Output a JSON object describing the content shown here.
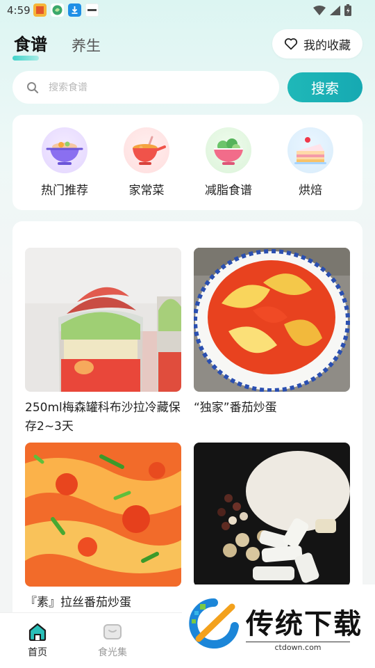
{
  "status_bar": {
    "time": "4:59"
  },
  "header": {
    "tabs": [
      {
        "label": "食谱",
        "active": true
      },
      {
        "label": "养生",
        "active": false
      }
    ],
    "favorites_label": "我的收藏"
  },
  "search": {
    "placeholder": "搜索食谱",
    "button_label": "搜索"
  },
  "categories": [
    {
      "label": "热门推荐",
      "icon": "hot-pot-icon"
    },
    {
      "label": "家常菜",
      "icon": "soup-bowl-icon"
    },
    {
      "label": "减脂食谱",
      "icon": "salad-bowl-icon"
    },
    {
      "label": "烘焙",
      "icon": "cake-icon"
    }
  ],
  "recipes": [
    {
      "title": "250ml梅森罐科布沙拉冷藏保存2~3天"
    },
    {
      "title": "“独家”番茄炒蛋"
    },
    {
      "title": "『素』拉丝番茄炒蛋"
    },
    {
      "title": ""
    }
  ],
  "bottom_nav": [
    {
      "label": "首页",
      "active": true,
      "icon": "home-icon"
    },
    {
      "label": "食光集",
      "active": false,
      "icon": "collection-icon"
    }
  ],
  "watermark": {
    "text": "传统下载",
    "url": "ctdown.com"
  },
  "colors": {
    "accent": "#1fb8b8",
    "active_nav": "#222222",
    "inactive_nav": "#9a9a9a"
  }
}
